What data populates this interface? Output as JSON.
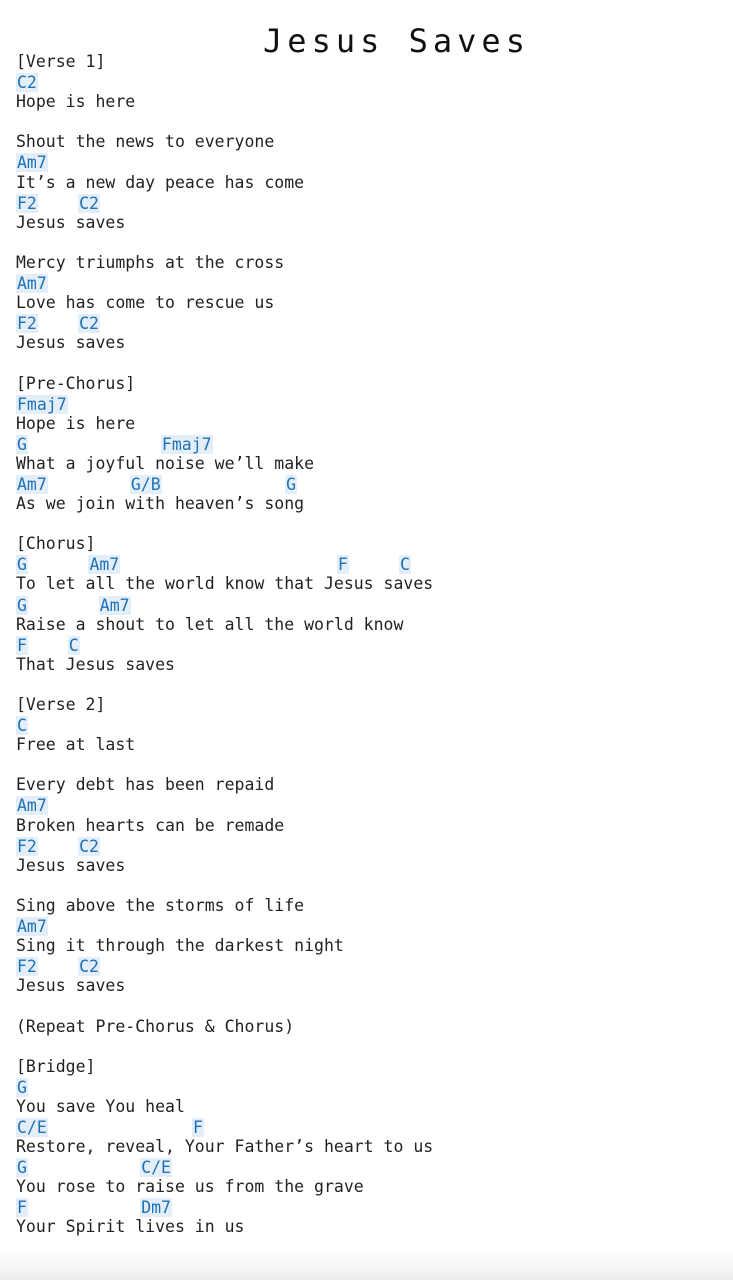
{
  "title": "Jesus Saves",
  "sheet": [
    {
      "type": "lyric",
      "text": "[Verse 1]"
    },
    {
      "type": "chords",
      "chords": [
        {
          "name": "C2",
          "col": 0
        }
      ]
    },
    {
      "type": "lyric",
      "text": "Hope is here"
    },
    {
      "type": "blank"
    },
    {
      "type": "lyric",
      "text": "Shout the news to everyone"
    },
    {
      "type": "chords",
      "chords": [
        {
          "name": "Am7",
          "col": 0
        }
      ]
    },
    {
      "type": "lyric",
      "text": "It’s a new day peace has come"
    },
    {
      "type": "chords",
      "chords": [
        {
          "name": "F2",
          "col": 0
        },
        {
          "name": "C2",
          "col": 6
        }
      ]
    },
    {
      "type": "lyric",
      "text": "Jesus saves"
    },
    {
      "type": "blank"
    },
    {
      "type": "lyric",
      "text": "Mercy triumphs at the cross"
    },
    {
      "type": "chords",
      "chords": [
        {
          "name": "Am7",
          "col": 0
        }
      ]
    },
    {
      "type": "lyric",
      "text": "Love has come to rescue us"
    },
    {
      "type": "chords",
      "chords": [
        {
          "name": "F2",
          "col": 0
        },
        {
          "name": "C2",
          "col": 6
        }
      ]
    },
    {
      "type": "lyric",
      "text": "Jesus saves"
    },
    {
      "type": "blank"
    },
    {
      "type": "lyric",
      "text": "[Pre-Chorus]"
    },
    {
      "type": "chords",
      "chords": [
        {
          "name": "Fmaj7",
          "col": 0
        }
      ]
    },
    {
      "type": "lyric",
      "text": "Hope is here"
    },
    {
      "type": "chords",
      "chords": [
        {
          "name": "G",
          "col": 0
        },
        {
          "name": "Fmaj7",
          "col": 14
        }
      ]
    },
    {
      "type": "lyric",
      "text": "What a joyful noise we’ll make"
    },
    {
      "type": "chords",
      "chords": [
        {
          "name": "Am7",
          "col": 0
        },
        {
          "name": "G/B",
          "col": 11
        },
        {
          "name": "G",
          "col": 26
        }
      ]
    },
    {
      "type": "lyric",
      "text": "As we join with heaven’s song"
    },
    {
      "type": "blank"
    },
    {
      "type": "lyric",
      "text": "[Chorus]"
    },
    {
      "type": "chords",
      "chords": [
        {
          "name": "G",
          "col": 0
        },
        {
          "name": "Am7",
          "col": 7
        },
        {
          "name": "F",
          "col": 31
        },
        {
          "name": "C",
          "col": 37
        }
      ]
    },
    {
      "type": "lyric",
      "text": "To let all the world know that Jesus saves"
    },
    {
      "type": "chords",
      "chords": [
        {
          "name": "G",
          "col": 0
        },
        {
          "name": "Am7",
          "col": 8
        }
      ]
    },
    {
      "type": "lyric",
      "text": "Raise a shout to let all the world know"
    },
    {
      "type": "chords",
      "chords": [
        {
          "name": "F",
          "col": 0
        },
        {
          "name": "C",
          "col": 5
        }
      ]
    },
    {
      "type": "lyric",
      "text": "That Jesus saves"
    },
    {
      "type": "blank"
    },
    {
      "type": "lyric",
      "text": "[Verse 2]"
    },
    {
      "type": "chords",
      "chords": [
        {
          "name": "C",
          "col": 0
        }
      ]
    },
    {
      "type": "lyric",
      "text": "Free at last"
    },
    {
      "type": "blank"
    },
    {
      "type": "lyric",
      "text": "Every debt has been repaid"
    },
    {
      "type": "chords",
      "chords": [
        {
          "name": "Am7",
          "col": 0
        }
      ]
    },
    {
      "type": "lyric",
      "text": "Broken hearts can be remade"
    },
    {
      "type": "chords",
      "chords": [
        {
          "name": "F2",
          "col": 0
        },
        {
          "name": "C2",
          "col": 6
        }
      ]
    },
    {
      "type": "lyric",
      "text": "Jesus saves"
    },
    {
      "type": "blank"
    },
    {
      "type": "lyric",
      "text": "Sing above the storms of life"
    },
    {
      "type": "chords",
      "chords": [
        {
          "name": "Am7",
          "col": 0
        }
      ]
    },
    {
      "type": "lyric",
      "text": "Sing it through the darkest night"
    },
    {
      "type": "chords",
      "chords": [
        {
          "name": "F2",
          "col": 0
        },
        {
          "name": "C2",
          "col": 6
        }
      ]
    },
    {
      "type": "lyric",
      "text": "Jesus saves"
    },
    {
      "type": "blank"
    },
    {
      "type": "lyric",
      "text": "(Repeat Pre-Chorus & Chorus)"
    },
    {
      "type": "blank"
    },
    {
      "type": "lyric",
      "text": "[Bridge]"
    },
    {
      "type": "chords",
      "chords": [
        {
          "name": "G",
          "col": 0
        }
      ]
    },
    {
      "type": "lyric",
      "text": "You save You heal"
    },
    {
      "type": "chords",
      "chords": [
        {
          "name": "C/E",
          "col": 0
        },
        {
          "name": "F",
          "col": 17
        }
      ]
    },
    {
      "type": "lyric",
      "text": "Restore, reveal, Your Father’s heart to us"
    },
    {
      "type": "chords",
      "chords": [
        {
          "name": "G",
          "col": 0
        },
        {
          "name": "C/E",
          "col": 12
        }
      ]
    },
    {
      "type": "lyric",
      "text": "You rose to raise us from the grave"
    },
    {
      "type": "chords",
      "chords": [
        {
          "name": "F",
          "col": 0
        },
        {
          "name": "Dm7",
          "col": 12
        }
      ]
    },
    {
      "type": "lyric",
      "text": "Your Spirit lives in us"
    }
  ]
}
